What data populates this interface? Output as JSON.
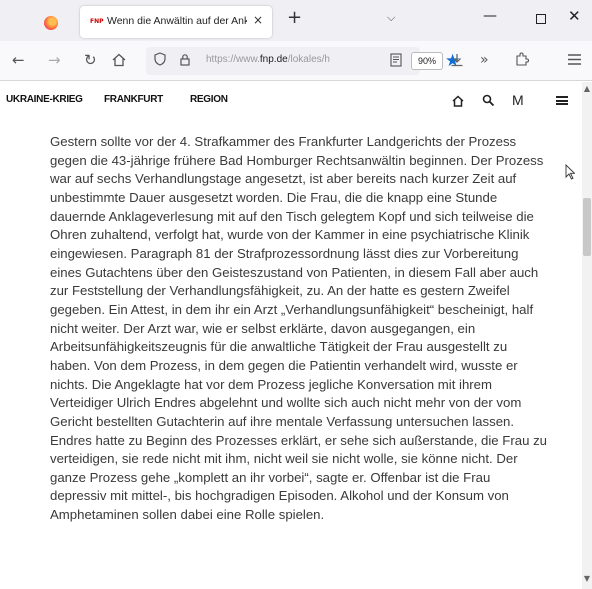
{
  "tab": {
    "favicon_text": "FNP",
    "title": "Wenn die Anwältin auf der Ankl",
    "close_glyph": "×",
    "new_tab_glyph": "+"
  },
  "nav": {
    "url_prefix": "https://www.",
    "url_domain": "fnp.de",
    "url_path": "/lokales/h",
    "zoom": "90%"
  },
  "site_nav": {
    "links": [
      "UKRAINE-KRIEG",
      "FRANKFURT",
      "REGION"
    ],
    "account_letter": "M"
  },
  "article": {
    "text": "Gestern sollte vor der 4. Strafkammer des Frankfurter Landgerichts der Prozess gegen die 43-jährige frühere Bad Homburger Rechtsanwältin beginnen. Der Prozess war auf sechs Verhandlungstage angesetzt, ist aber bereits nach kurzer Zeit auf unbestimmte Dauer ausgesetzt worden. Die Frau, die die knapp eine Stunde dauernde Anklageverlesung mit auf den Tisch gelegtem Kopf und sich teilweise die Ohren zuhaltend, verfolgt hat, wurde von der Kammer in eine psychiatrische Klinik eingewiesen. Paragraph 81 der Strafprozessordnung lässt dies zur Vorbereitung eines Gutachtens über den Geisteszustand von Patienten, in diesem Fall aber auch zur Feststellung der Verhandlungsfähigkeit, zu. An der hatte es gestern Zweifel gegeben. Ein Attest, in dem ihr ein Arzt „Verhandlungsunfähigkeit“ bescheinigt, half nicht weiter. Der Arzt war, wie er selbst erklärte, davon ausgegangen, ein Arbeitsunfähigkeitszeugnis für die anwaltliche Tätigkeit der Frau ausgestellt zu haben. Von dem Prozess, in dem gegen die Patientin verhandelt wird, wusste er nichts. Die Angeklagte hat vor dem Prozess jegliche Konversation mit ihrem Verteidiger Ulrich Endres abgelehnt und wollte sich auch nicht mehr von der vom Gericht bestellten Gutachterin auf ihre mentale Verfassung untersuchen lassen. Endres hatte zu Beginn des Prozesses erklärt, er sehe sich außerstande, die Frau zu verteidigen, sie rede nicht mit ihm, nicht weil sie nicht wolle, sie könne nicht. Der ganze Prozess gehe „komplett an ihr vorbei“, sagte er. Offenbar ist die Frau depressiv mit mittel-, bis hochgradigen Episoden. Alkohol und der Konsum von Amphetaminen sollen dabei eine Rolle spielen."
  },
  "colors": {
    "accent_star": "#0b6fd5",
    "chrome_bg": "#f0f0f4",
    "body_text": "#3a3a3a"
  },
  "icons": [
    "firefox-icon",
    "close-icon",
    "plus-icon",
    "chevron-down-icon",
    "minimize-icon",
    "maximize-icon",
    "back-arrow-icon",
    "forward-arrow-icon",
    "reload-icon",
    "home-icon",
    "shield-icon",
    "lock-icon",
    "reader-view-icon",
    "star-icon",
    "download-icon",
    "overflow-icon",
    "extensions-icon",
    "menu-icon",
    "search-icon",
    "hamburger-icon",
    "cursor-icon"
  ]
}
